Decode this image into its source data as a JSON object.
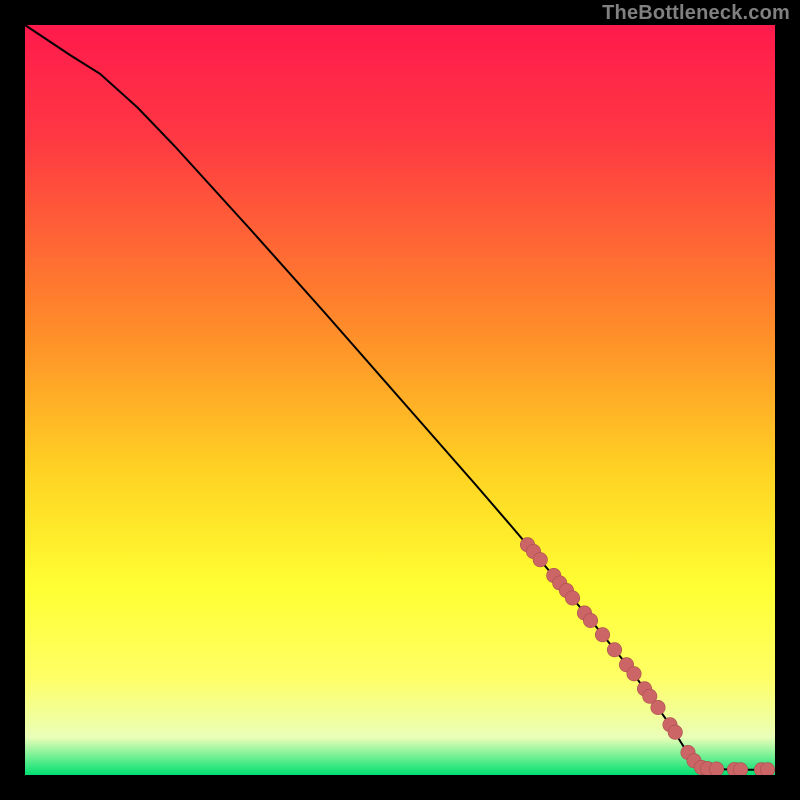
{
  "attribution": "TheBottleneck.com",
  "colors": {
    "gradient_stops": [
      "#ff1a4c",
      "#ff3843",
      "#ff8a2a",
      "#ffd423",
      "#ffff33",
      "#ffff66",
      "#eaffb8",
      "#00e070"
    ],
    "curve": "#000000",
    "marker_fill": "#cc6666",
    "marker_stroke": "#a94d4d",
    "background": "#000000"
  },
  "chart_data": {
    "type": "line",
    "title": "",
    "xlabel": "",
    "ylabel": "",
    "xlim": [
      0,
      100
    ],
    "ylim": [
      0,
      100
    ],
    "grid": false,
    "legend": false,
    "series": [
      {
        "name": "threshold-curve",
        "x": [
          0,
          3,
          6,
          10,
          15,
          20,
          25,
          30,
          35,
          40,
          45,
          50,
          55,
          60,
          65,
          70,
          75,
          80,
          82,
          84,
          86,
          88,
          90,
          92,
          95,
          100
        ],
        "y": [
          100,
          98,
          96,
          93.5,
          89,
          83.8,
          78.3,
          72.8,
          67.2,
          61.6,
          55.9,
          50.2,
          44.5,
          38.8,
          33,
          27.1,
          21.2,
          15,
          12.3,
          9.5,
          6.7,
          3.5,
          1.2,
          0.8,
          0.7,
          0.7
        ]
      },
      {
        "name": "markers",
        "points": [
          {
            "x": 67.0,
            "y": 30.7
          },
          {
            "x": 67.8,
            "y": 29.8
          },
          {
            "x": 68.7,
            "y": 28.7
          },
          {
            "x": 70.5,
            "y": 26.6
          },
          {
            "x": 71.3,
            "y": 25.6
          },
          {
            "x": 72.2,
            "y": 24.6
          },
          {
            "x": 73.0,
            "y": 23.6
          },
          {
            "x": 74.6,
            "y": 21.6
          },
          {
            "x": 75.4,
            "y": 20.6
          },
          {
            "x": 77.0,
            "y": 18.7
          },
          {
            "x": 78.6,
            "y": 16.7
          },
          {
            "x": 80.2,
            "y": 14.7
          },
          {
            "x": 81.2,
            "y": 13.5
          },
          {
            "x": 82.6,
            "y": 11.5
          },
          {
            "x": 83.3,
            "y": 10.5
          },
          {
            "x": 84.4,
            "y": 9.0
          },
          {
            "x": 86.0,
            "y": 6.7
          },
          {
            "x": 86.7,
            "y": 5.7
          },
          {
            "x": 88.4,
            "y": 3.0
          },
          {
            "x": 89.2,
            "y": 1.9
          },
          {
            "x": 90.2,
            "y": 1.0
          },
          {
            "x": 91.0,
            "y": 0.85
          },
          {
            "x": 92.2,
            "y": 0.8
          },
          {
            "x": 94.6,
            "y": 0.72
          },
          {
            "x": 95.4,
            "y": 0.7
          },
          {
            "x": 98.2,
            "y": 0.7
          },
          {
            "x": 99.0,
            "y": 0.7
          }
        ]
      }
    ]
  }
}
